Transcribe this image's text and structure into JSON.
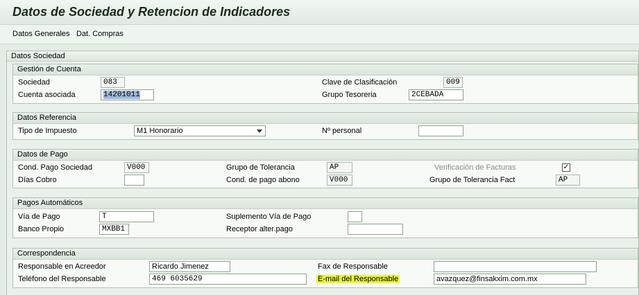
{
  "window": {
    "title": "Datos de Sociedad y Retencion de Indicadores"
  },
  "menu": [
    "Datos Generales",
    "Dat. Compras"
  ],
  "panel": {
    "title": "Datos Sociedad"
  },
  "gestion": {
    "title": "Gestión de Cuenta",
    "sociedad_label": "Sociedad",
    "sociedad_value": "083",
    "cuenta_label": "Cuenta asociada",
    "cuenta_value": "14201011",
    "clave_label": "Clave de Clasificación",
    "clave_value": "009",
    "grupo_label": "Grupo Tesoreria",
    "grupo_value": "2CEBADA"
  },
  "referencia": {
    "title": "Datos Referencia",
    "tipo_label": "Tipo de Impuesto",
    "tipo_value": "M1 Honorario",
    "personal_label": "Nº personal",
    "personal_value": ""
  },
  "pago": {
    "title": "Datos de Pago",
    "cond_label": "Cond. Pago Sociedad",
    "cond_value": "V000",
    "dias_label": "Días Cobro",
    "dias_value": "",
    "tolerancia_label": "Grupo de Tolerancia",
    "tolerancia_value": "AP",
    "abono_label": "Cond. de pago abono",
    "abono_value": "V000",
    "verif_label": "Verificación de Facturas",
    "verif_checked": "✓",
    "tol_fact_label": "Grupo de Tolerancia Fact",
    "tol_fact_value": "AP"
  },
  "automaticos": {
    "title": "Pagos Automáticos",
    "via_label": "Vía de Pago",
    "via_value": "T",
    "banco_label": "Banco Propio",
    "banco_value": "MXBB1",
    "suplemento_label": "Suplemento Vía de Pago",
    "suplemento_value": "",
    "receptor_label": "Receptor alter.pago",
    "receptor_value": ""
  },
  "correspondencia": {
    "title": "Correspondencia",
    "responsable_label": "Responsable en Acreedor",
    "responsable_value": "Ricardo Jimenez",
    "telefono_label": "Teléfono del Responsable",
    "telefono_value": "469 6035629",
    "fax_label": "Fax de Responsable",
    "fax_value": "",
    "email_label": "E-mail del Responsable",
    "email_value": "avazquez@finsakxim.com.mx"
  },
  "colors": {
    "background": "#e4ede4",
    "highlight": "#e8f535",
    "selection": "#9fb8df"
  }
}
